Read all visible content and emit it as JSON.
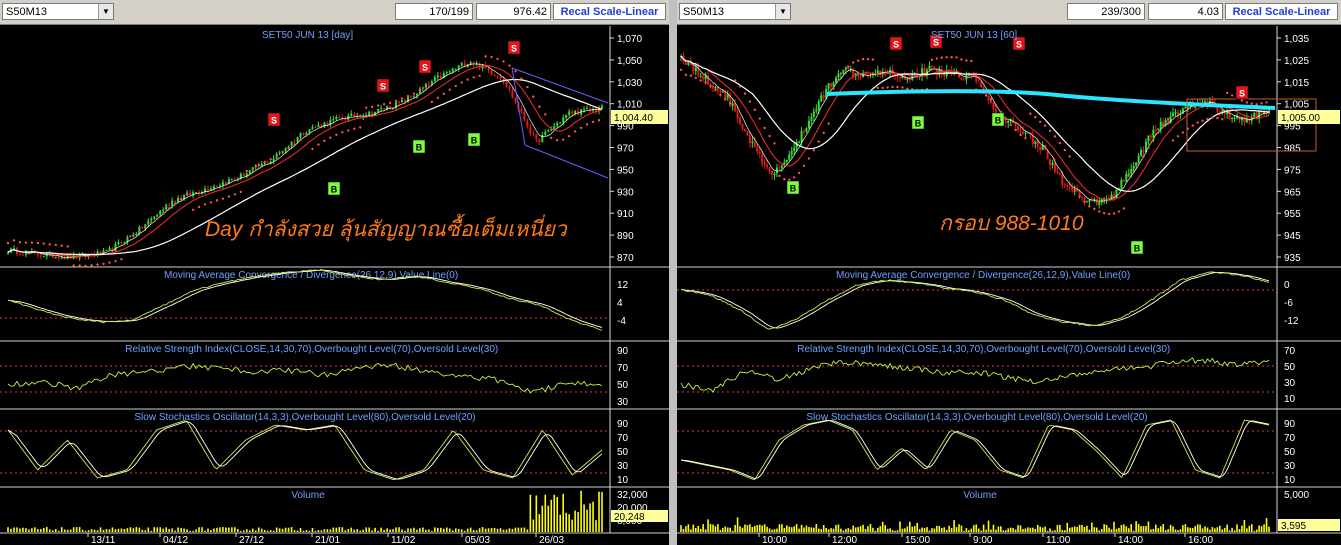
{
  "colors": {
    "bg": "#000000",
    "axis": "#ffff80",
    "sigRed": "#e3151a",
    "sigGreen": "#7cff3a",
    "sar": "#ff5050",
    "ma": "#ffffff",
    "maRed": "#ff2a2a",
    "cyan": "#29e6ff",
    "macd": "#c8f040",
    "signal": "#ffffff",
    "volume": "#ffff00",
    "tag": "#ffff99"
  },
  "left": {
    "symbol": "S50M13",
    "counter": "170/199",
    "price": "976.42",
    "recal": "Recal Scale-Linear",
    "title": "SET50 JUN 13   [day]",
    "annotation": "Day กำลังสวย ลุ้นสัญญาณซื้อเต็มเหนี่ยว",
    "last_price": "1,004.40",
    "macd_title": "Moving Average Convergence / Divergence(26,12,9),Value Line(0)",
    "rsi_title": "Relative Strength Index(CLOSE,14,30,70),Overbought Level(70),Oversold Level(30)",
    "stoch_title": "Slow Stochastics Oscillator(14,3,3),Overbought Level(80),Oversold Level(20)",
    "vol_title": "Volume",
    "vol_last": "20,248",
    "price_ticks": [
      "1,070",
      "1,050",
      "1,030",
      "1,010",
      "990",
      "970",
      "950",
      "930",
      "910",
      "890",
      "870"
    ],
    "macd_ticks": [
      "12",
      "4",
      "-4"
    ],
    "rsi_ticks": [
      "90",
      "70",
      "50",
      "30"
    ],
    "stoch_ticks": [
      "90",
      "70",
      "50",
      "30",
      "10"
    ],
    "vol_ticks": [
      "32,000",
      "20,000",
      "8,000"
    ],
    "x_ticks": [
      "13/11",
      "04/12",
      "27/12",
      "21/01",
      "11/02",
      "05/03",
      "26/03"
    ],
    "signals": [
      {
        "t": "S",
        "label": "S",
        "x": 274,
        "y": 120
      },
      {
        "t": "S",
        "label": "S",
        "x": 383,
        "y": 86
      },
      {
        "t": "S",
        "label": "S",
        "x": 425,
        "y": 67
      },
      {
        "t": "S",
        "label": "S",
        "x": 514,
        "y": 48
      },
      {
        "t": "B",
        "label": "B",
        "x": 334,
        "y": 189
      },
      {
        "t": "B",
        "label": "B",
        "x": 419,
        "y": 147
      },
      {
        "t": "B",
        "label": "B",
        "x": 474,
        "y": 140
      }
    ]
  },
  "right": {
    "symbol": "S50M13",
    "counter": "239/300",
    "price": "4.03",
    "recal": "Recal Scale-Linear",
    "title": "SET50 JUN 13   [60]",
    "annotation": "กรอบ 988-1010",
    "last_price": "1,005.00",
    "macd_title": "Moving Average Convergence / Divergence(26,12,9),Value Line(0)",
    "rsi_title": "Relative Strength Index(CLOSE,14,30,70),Overbought Level(70),Oversold Level(30)",
    "stoch_title": "Slow Stochastics Oscillator(14,3,3),Overbought Level(80),Oversold Level(20)",
    "vol_title": "Volume",
    "vol_last": "3,595",
    "price_ticks": [
      "1,035",
      "1,025",
      "1,015",
      "1,005",
      "995",
      "985",
      "975",
      "965",
      "955",
      "945",
      "935"
    ],
    "macd_ticks": [
      "0",
      "-6",
      "-12"
    ],
    "rsi_ticks": [
      "70",
      "50",
      "30",
      "10"
    ],
    "stoch_ticks": [
      "90",
      "70",
      "50",
      "30",
      "10"
    ],
    "vol_ticks": [
      "5,000"
    ],
    "x_ticks": [
      "10:00",
      "12:00",
      "15:00",
      "9:00",
      "11:00",
      "14:00",
      "16:00"
    ],
    "signals": [
      {
        "t": "S",
        "label": "S",
        "x": 896,
        "y": 44
      },
      {
        "t": "S",
        "label": "S",
        "x": 936,
        "y": 42
      },
      {
        "t": "S",
        "label": "S",
        "x": 1019,
        "y": 44
      },
      {
        "t": "S",
        "label": "S",
        "x": 1242,
        "y": 93
      },
      {
        "t": "B",
        "label": "B",
        "x": 793,
        "y": 188
      },
      {
        "t": "B",
        "label": "B",
        "x": 918,
        "y": 123
      },
      {
        "t": "B",
        "label": "B",
        "x": 998,
        "y": 120
      },
      {
        "t": "B",
        "label": "B",
        "x": 1137,
        "y": 248
      }
    ]
  },
  "chart_data": [
    {
      "type": "line",
      "title": "SET50 JUN 13 [day]",
      "panel": "price",
      "x": [
        "13/11",
        "04/12",
        "27/12",
        "21/01",
        "11/02",
        "05/03",
        "26/03"
      ],
      "series": [
        {
          "values": [
            880,
            878,
            925,
            960,
            998,
            1040,
            1004.4
          ]
        }
      ],
      "ylim": [
        870,
        1075
      ]
    },
    {
      "type": "line",
      "title": "SET50 JUN 13 [60]",
      "panel": "price",
      "x": [
        "10:00",
        "12:00",
        "15:00",
        "9:00",
        "11:00",
        "14:00",
        "16:00"
      ],
      "series": [
        {
          "values": [
            1020,
            975,
            1022,
            1018,
            992,
            960,
            1005
          ]
        }
      ],
      "ylim": [
        932,
        1042
      ]
    }
  ]
}
